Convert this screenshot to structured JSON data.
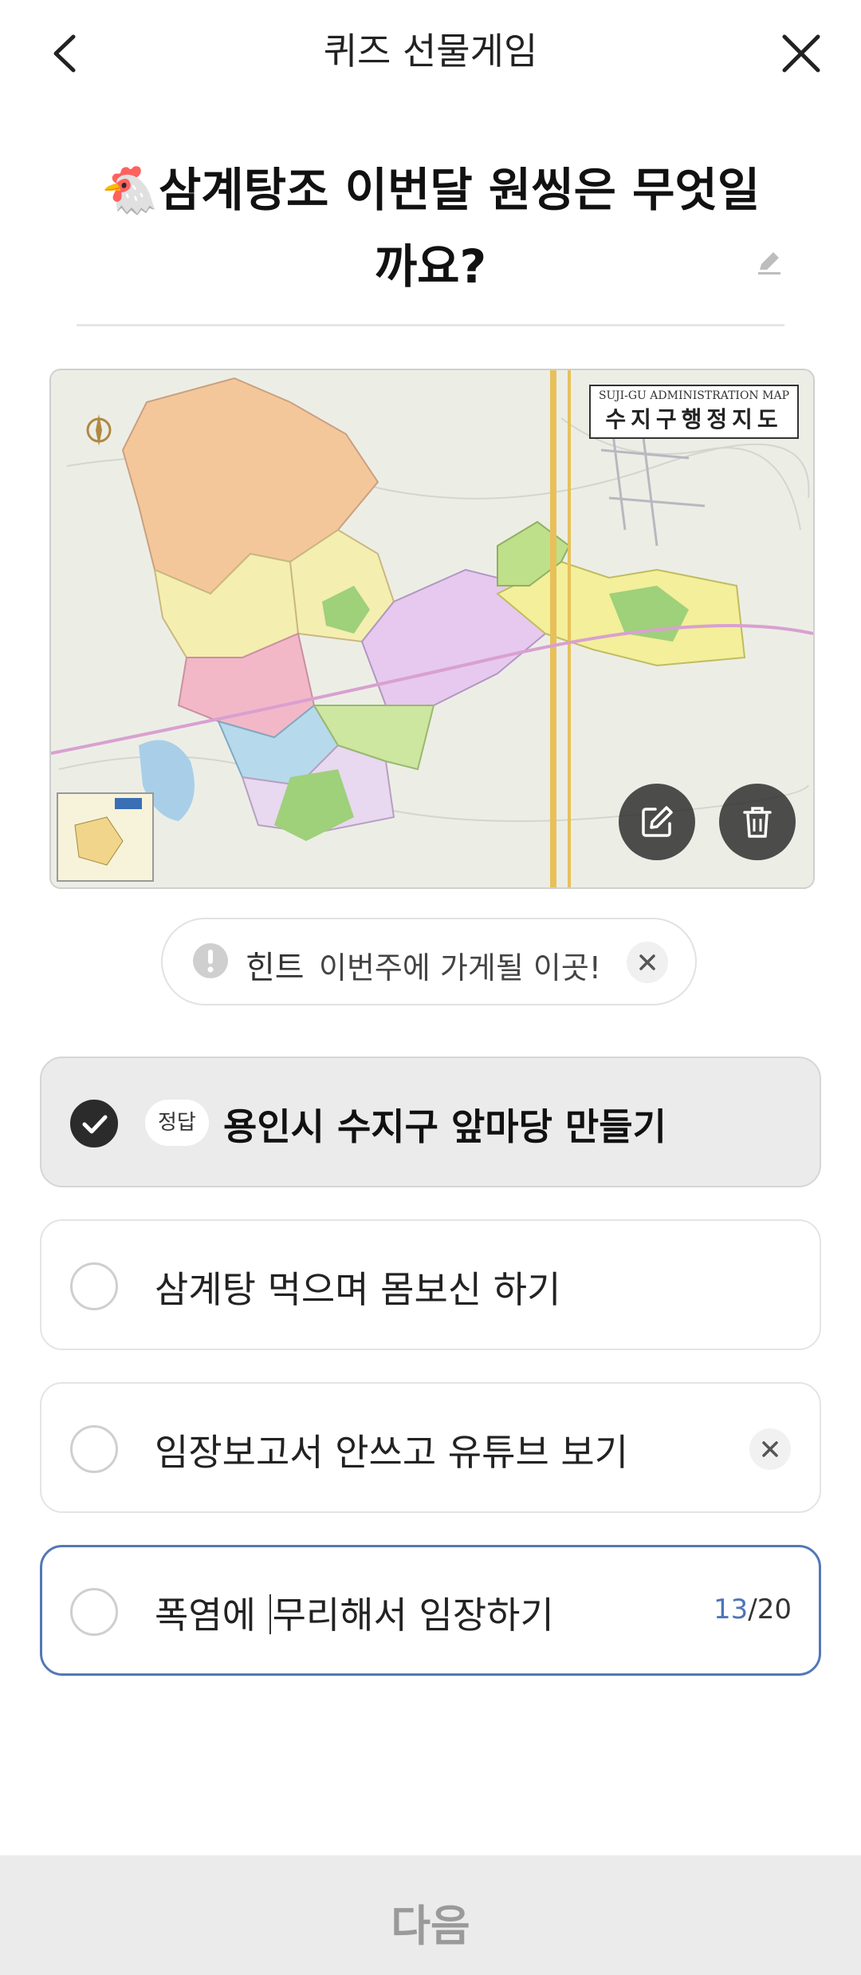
{
  "header": {
    "title": "퀴즈 선물게임"
  },
  "question": {
    "emoji": "🐔",
    "text": "삼계탕조 이번달 원씽은 무엇일까요?"
  },
  "map": {
    "title_en": "SUJI-GU ADMINISTRATION MAP",
    "title_ko": "수지구행정지도"
  },
  "hint": {
    "label": "힌트",
    "text": "이번주에 가게될 이곳!"
  },
  "options": [
    {
      "badge": "정답",
      "text": "용인시 수지구 앞마당 만들기",
      "selected": true
    },
    {
      "text": "삼계탕 먹으며 몸보신 하기",
      "selected": false
    },
    {
      "text": "임장보고서 안쓰고 유튜브 보기",
      "selected": false
    },
    {
      "text_before": "폭염에 ",
      "text_after": "무리해서 임장하기",
      "selected": false,
      "counter_current": "13",
      "counter_max": "/20"
    }
  ],
  "footer": {
    "next_label": "다음"
  },
  "colors": {
    "accent": "#5378b5",
    "checked": "#2b2b2b",
    "footer_bg": "#ebebeb"
  }
}
